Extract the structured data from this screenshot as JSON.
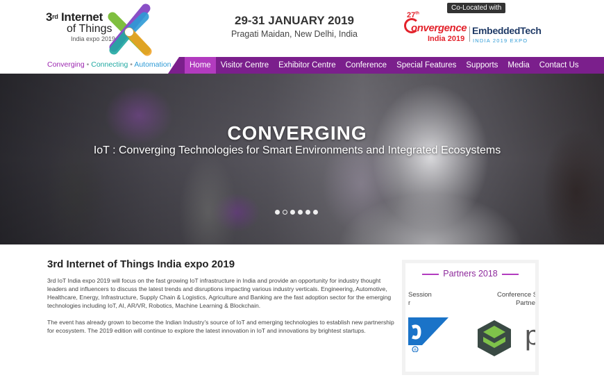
{
  "header": {
    "logo": {
      "ordinal": "3",
      "ordinal_suffix": "rd",
      "title_line1": "Internet",
      "title_line2": "of Things",
      "title_line3": "India expo 2019"
    },
    "tagline": {
      "part1": "Converging",
      "part2": "Connecting",
      "part3": "Automation",
      "separator": "•"
    },
    "event": {
      "date": "29-31 JANUARY 2019",
      "venue": "Pragati Maidan, New Delhi, India"
    },
    "colocated": {
      "label": "Co-Located with",
      "convergence_number": "27",
      "convergence_suffix": "th",
      "convergence_name": "onvergence",
      "convergence_year": "India 2019",
      "embedded_name": "EmbeddedTech",
      "embedded_sub": "INDIA 2019 EXPO"
    }
  },
  "nav": {
    "items": [
      {
        "label": "Home",
        "active": true
      },
      {
        "label": "Visitor Centre",
        "active": false
      },
      {
        "label": "Exhibitor Centre",
        "active": false
      },
      {
        "label": "Conference",
        "active": false
      },
      {
        "label": "Special Features",
        "active": false
      },
      {
        "label": "Supports",
        "active": false
      },
      {
        "label": "Media",
        "active": false
      },
      {
        "label": "Contact Us",
        "active": false
      }
    ]
  },
  "hero": {
    "title": "CONVERGING",
    "subtitle": "IoT : Converging Technologies for Smart Environments and Integrated Ecosystems",
    "slide_count": 6,
    "active_slide": 2
  },
  "main": {
    "title": "3rd Internet of Things India expo 2019",
    "paragraph1": "3rd IoT India expo 2019 will focus on the fast growing IoT infrastructure in India and provide an opportunity for industry thought leaders and influencers to discuss the latest trends and disruptions impacting various industry verticals. Engineering, Automotive, Healthcare, Energy, Infrastructure, Supply Chain & Logistics, Agriculture and Banking are the fast adoption sector for the emerging technologies including IoT, AI, AR/VR, Robotics, Machine Learning & Blockchain.",
    "paragraph2": "The event has already grown to become the Indian Industry's source of IoT and emerging technologies to establish new partnership for ecosystem. The 2019 edition will continue to explore the latest innovation in IoT and innovations by brightest startups."
  },
  "partners": {
    "title": "Partners 2018",
    "label1_line1": "Session",
    "label1_line2": "r",
    "label2_line1": "Conference S",
    "label2_line2": "Partne",
    "logo1_mark": "®",
    "logo3_letter": "p"
  },
  "colors": {
    "nav_bg": "#7b1f8c",
    "nav_active": "#b23bbf",
    "convergence_red": "#e3222b",
    "embedded_blue": "#1f3a66",
    "partners_purple": "#8e2a9c"
  }
}
